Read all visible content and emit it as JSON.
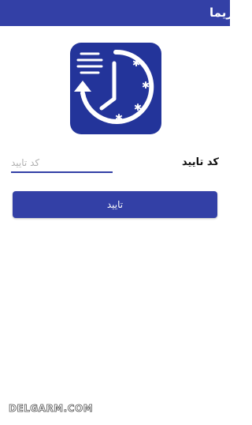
{
  "app_bar": {
    "title": "ریما",
    "color": "#3340a6"
  },
  "logo": {
    "icon": "clock-history-icon",
    "background": "#23349a"
  },
  "form": {
    "code_label": "کد تایید",
    "code_placeholder": "کد تایید",
    "code_value": "",
    "submit_label": "تایید"
  },
  "watermark": {
    "text": "DELGARM.COM"
  }
}
